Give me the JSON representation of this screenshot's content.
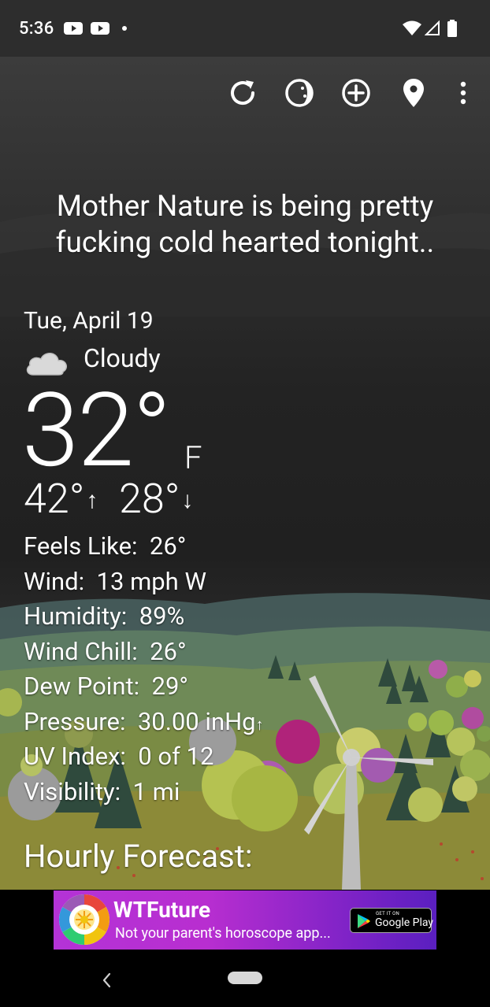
{
  "status_bar": {
    "time": "5:36",
    "icons": [
      "youtube-icon",
      "youtube-icon",
      "notification-dot-icon",
      "wifi-icon",
      "signal-icon",
      "battery-icon"
    ]
  },
  "toolbar": {
    "icons": [
      "refresh-icon",
      "moon-phase-icon",
      "add-location-icon",
      "location-pin-icon",
      "more-vert-icon"
    ]
  },
  "headline": "Mother Nature is being pretty fucking cold hearted tonight..",
  "weather": {
    "date": "Tue, April 19",
    "condition": "Cloudy",
    "condition_icon": "cloud-icon",
    "temperature": "32°",
    "unit": "F",
    "high": "42°",
    "high_arrow": "↑",
    "low": "28°",
    "low_arrow": "↓",
    "details": [
      {
        "label": "Feels Like:",
        "value": "26°"
      },
      {
        "label": "Wind:",
        "value": "13 mph W"
      },
      {
        "label": "Humidity:",
        "value": "89%"
      },
      {
        "label": "Wind Chill:",
        "value": "26°"
      },
      {
        "label": "Dew Point:",
        "value": "29°"
      },
      {
        "label": "Pressure:",
        "value": "30.00 inHg",
        "trend": "↑"
      },
      {
        "label": "UV Index:",
        "value": "0 of 12"
      },
      {
        "label": "Visibility:",
        "value": "1 mi"
      }
    ],
    "hourly_title": "Hourly Forecast:"
  },
  "ad": {
    "title": "WTFuture",
    "subtitle": "Not your parent's horoscope app...",
    "badge_small": "GET IT ON",
    "badge_big": "Google Play"
  },
  "colors": {
    "ad_gradient_start": "#b433d6",
    "ad_gradient_end": "#5a1fc0",
    "text": "#ffffff"
  }
}
